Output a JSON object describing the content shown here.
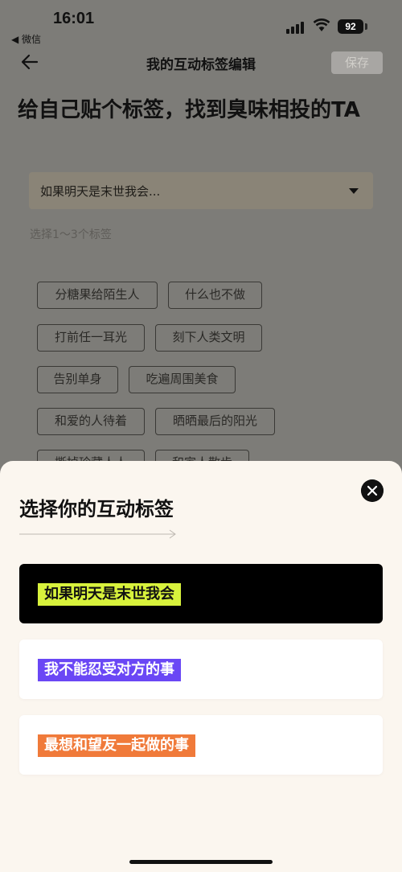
{
  "status_bar": {
    "time": "16:01",
    "back_app": "◀ 微信",
    "battery": "92"
  },
  "nav": {
    "title": "我的互动标签编辑",
    "save_label": "保存"
  },
  "headline": "给自己贴个标签，找到臭味相投的TA",
  "dropdown": {
    "selected": "如果明天是末世我会..."
  },
  "hint": "选择1～3个标签",
  "tags": [
    "分糖果给陌生人",
    "什么也不做",
    "打前任一耳光",
    "刻下人类文明",
    "告别单身",
    "吃遍周围美食",
    "和爱的人待着",
    "晒晒最后的阳光",
    "撕掉珍藏人人",
    "和家人散步"
  ],
  "sheet": {
    "title": "选择你的互动标签",
    "options": [
      {
        "label": "如果明天是末世我会",
        "highlight": "#d8f23c",
        "text_color": "#111111",
        "card": "#000000"
      },
      {
        "label": "我不能忍受对方的事",
        "highlight": "#6a47f5",
        "text_color": "#ffffff",
        "card": "#ffffff"
      },
      {
        "label": "最想和望友一起做的事",
        "highlight": "#f07a3a",
        "text_color": "#ffffff",
        "card": "#ffffff"
      }
    ]
  }
}
